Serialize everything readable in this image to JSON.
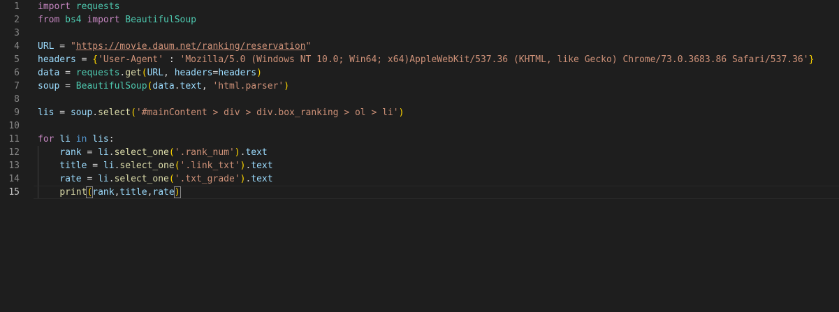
{
  "editor": {
    "current_line": 15,
    "lines": [
      {
        "n": "1",
        "tokens": [
          [
            "kw",
            "import"
          ],
          [
            "op",
            " "
          ],
          [
            "mod",
            "requests"
          ]
        ]
      },
      {
        "n": "2",
        "tokens": [
          [
            "kw",
            "from"
          ],
          [
            "op",
            " "
          ],
          [
            "mod",
            "bs4"
          ],
          [
            "op",
            " "
          ],
          [
            "kw",
            "import"
          ],
          [
            "op",
            " "
          ],
          [
            "mod",
            "BeautifulSoup"
          ]
        ]
      },
      {
        "n": "3",
        "tokens": []
      },
      {
        "n": "4",
        "tokens": [
          [
            "var",
            "URL"
          ],
          [
            "op",
            " = "
          ],
          [
            "str",
            "\""
          ],
          [
            "url",
            "https://movie.daum.net/ranking/reservation"
          ],
          [
            "str",
            "\""
          ]
        ]
      },
      {
        "n": "5",
        "tokens": [
          [
            "var",
            "headers"
          ],
          [
            "op",
            " = "
          ],
          [
            "p1",
            "{"
          ],
          [
            "str",
            "'User-Agent'"
          ],
          [
            "op",
            " : "
          ],
          [
            "str",
            "'Mozilla/5.0 (Windows NT 10.0; Win64; x64)AppleWebKit/537.36 (KHTML, like Gecko) Chrome/73.0.3683.86 Safari/537.36'"
          ],
          [
            "p1",
            "}"
          ]
        ]
      },
      {
        "n": "6",
        "tokens": [
          [
            "var",
            "data"
          ],
          [
            "op",
            " = "
          ],
          [
            "mod",
            "requests"
          ],
          [
            "op",
            "."
          ],
          [
            "fn",
            "get"
          ],
          [
            "p1",
            "("
          ],
          [
            "var",
            "URL"
          ],
          [
            "op",
            ", "
          ],
          [
            "var",
            "headers"
          ],
          [
            "op",
            "="
          ],
          [
            "var",
            "headers"
          ],
          [
            "p1",
            ")"
          ]
        ]
      },
      {
        "n": "7",
        "tokens": [
          [
            "var",
            "soup"
          ],
          [
            "op",
            " = "
          ],
          [
            "mod",
            "BeautifulSoup"
          ],
          [
            "p1",
            "("
          ],
          [
            "var",
            "data"
          ],
          [
            "op",
            "."
          ],
          [
            "var",
            "text"
          ],
          [
            "op",
            ", "
          ],
          [
            "str",
            "'html.parser'"
          ],
          [
            "p1",
            ")"
          ]
        ]
      },
      {
        "n": "8",
        "tokens": []
      },
      {
        "n": "9",
        "tokens": [
          [
            "var",
            "lis"
          ],
          [
            "op",
            " = "
          ],
          [
            "var",
            "soup"
          ],
          [
            "op",
            "."
          ],
          [
            "fn",
            "select"
          ],
          [
            "p1",
            "("
          ],
          [
            "str",
            "'#mainContent > div > div.box_ranking > ol > li'"
          ],
          [
            "p1",
            ")"
          ]
        ]
      },
      {
        "n": "10",
        "tokens": []
      },
      {
        "n": "11",
        "tokens": [
          [
            "kw",
            "for"
          ],
          [
            "op",
            " "
          ],
          [
            "var",
            "li"
          ],
          [
            "op",
            " "
          ],
          [
            "kw2",
            "in"
          ],
          [
            "op",
            " "
          ],
          [
            "var",
            "lis"
          ],
          [
            "op",
            ":"
          ]
        ]
      },
      {
        "n": "12",
        "tokens": [
          [
            "op",
            "    "
          ],
          [
            "var",
            "rank"
          ],
          [
            "op",
            " = "
          ],
          [
            "var",
            "li"
          ],
          [
            "op",
            "."
          ],
          [
            "fn",
            "select_one"
          ],
          [
            "p1",
            "("
          ],
          [
            "str",
            "'.rank_num'"
          ],
          [
            "p1",
            ")"
          ],
          [
            "op",
            "."
          ],
          [
            "var",
            "text"
          ]
        ]
      },
      {
        "n": "13",
        "tokens": [
          [
            "op",
            "    "
          ],
          [
            "var",
            "title"
          ],
          [
            "op",
            " = "
          ],
          [
            "var",
            "li"
          ],
          [
            "op",
            "."
          ],
          [
            "fn",
            "select_one"
          ],
          [
            "p1",
            "("
          ],
          [
            "str",
            "'.link_txt'"
          ],
          [
            "p1",
            ")"
          ],
          [
            "op",
            "."
          ],
          [
            "var",
            "text"
          ]
        ]
      },
      {
        "n": "14",
        "tokens": [
          [
            "op",
            "    "
          ],
          [
            "var",
            "rate"
          ],
          [
            "op",
            " = "
          ],
          [
            "var",
            "li"
          ],
          [
            "op",
            "."
          ],
          [
            "fn",
            "select_one"
          ],
          [
            "p1",
            "("
          ],
          [
            "str",
            "'.txt_grade'"
          ],
          [
            "p1",
            ")"
          ],
          [
            "op",
            "."
          ],
          [
            "var",
            "text"
          ]
        ]
      },
      {
        "n": "15",
        "tokens": [
          [
            "op",
            "    "
          ],
          [
            "fn",
            "print"
          ],
          [
            "p1",
            "(",
            true
          ],
          [
            "var",
            "rank"
          ],
          [
            "op",
            ","
          ],
          [
            "var",
            "title"
          ],
          [
            "op",
            ","
          ],
          [
            "var",
            "rate"
          ],
          [
            "p1",
            ")",
            true
          ]
        ]
      }
    ],
    "colors": {
      "background": "#1e1e1e",
      "keyword": "#c586c0",
      "string": "#ce9178",
      "function": "#dcdcaa",
      "variable": "#9cdcfe",
      "module": "#4ec9b0",
      "bracket": "#ffd700"
    }
  }
}
